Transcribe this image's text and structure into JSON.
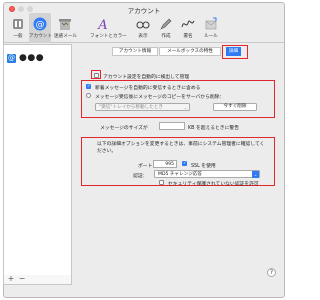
{
  "window": {
    "title": "アカウント"
  },
  "toolbar": {
    "items": [
      {
        "label": "一般",
        "icon": "switch-icon"
      },
      {
        "label": "アカウント",
        "icon": "at-icon"
      },
      {
        "label": "迷惑メール",
        "icon": "junk-mail-icon"
      },
      {
        "label": "フォントとカラー",
        "icon": "fonts-colors-icon"
      },
      {
        "label": "表示",
        "icon": "glasses-icon"
      },
      {
        "label": "作成",
        "icon": "compose-icon"
      },
      {
        "label": "署名",
        "icon": "signature-icon"
      },
      {
        "label": "ルール",
        "icon": "rules-icon"
      }
    ],
    "selected_index": 1
  },
  "sidebar": {
    "account_icon": "@",
    "account_name": "●●●",
    "add_label": "+",
    "remove_label": "−"
  },
  "tabs": [
    {
      "label": "アカウント情報"
    },
    {
      "label": "メールボックスの特性"
    },
    {
      "label": "詳細"
    }
  ],
  "detail": {
    "auto_detect_label": "アカウント設定を自動的に検出して管理",
    "auto_detect_checked": false,
    "download_label": "新着メッセージを自動的に受信するときに含める",
    "download_checked": true,
    "keep_copy_label": "メッセージ受信後にメッセージのコピーをサーバから削除：",
    "keep_copy_checked": false,
    "delete_after_value": "\"受信\"トレイから移動したとき",
    "remove_now_label": "今すぐ削除",
    "size_prefix": "メッセージのサイズが",
    "size_value": "",
    "size_suffix": "KB を超えるときに警告",
    "ssl_notice": "以下の詳細オプションを変更するときは、事前にシステム管理者に確認してください。",
    "port_label": "ポート：",
    "port_value": "995",
    "ssl_label": "SSL を使用",
    "ssl_checked": true,
    "auth_label": "認証：",
    "auth_value": "MD5 チャレンジ応答",
    "insecure_label": "セキュリティ保護されていない認証を許可",
    "insecure_checked": false
  },
  "help_label": "?",
  "colors": {
    "accent": "#2f7bf5",
    "highlight": "#e3262c",
    "close": "#fd5e56"
  }
}
